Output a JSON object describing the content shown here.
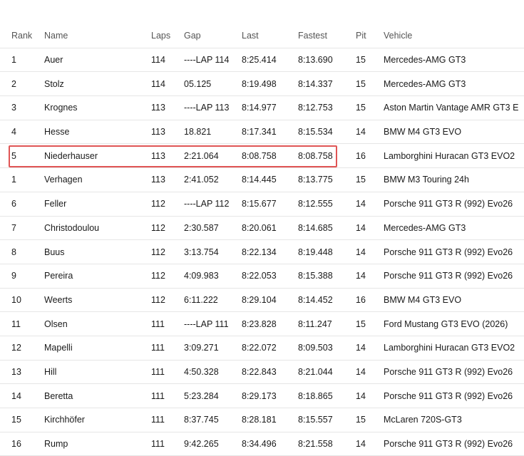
{
  "columns": {
    "rank": "Rank",
    "name": "Name",
    "laps": "Laps",
    "gap": "Gap",
    "last": "Last",
    "fastest": "Fastest",
    "pit": "Pit",
    "vehicle": "Vehicle"
  },
  "rows": [
    {
      "rank": "1",
      "name": "Auer",
      "laps": "114",
      "gap": "----LAP 114",
      "last": "8:25.414",
      "fastest": "8:13.690",
      "pit": "15",
      "vehicle": "Mercedes-AMG GT3"
    },
    {
      "rank": "2",
      "name": "Stolz",
      "laps": "114",
      "gap": "05.125",
      "last": "8:19.498",
      "fastest": "8:14.337",
      "pit": "15",
      "vehicle": "Mercedes-AMG GT3"
    },
    {
      "rank": "3",
      "name": "Krognes",
      "laps": "113",
      "gap": "----LAP 113",
      "last": "8:14.977",
      "fastest": "8:12.753",
      "pit": "15",
      "vehicle": "Aston Martin Vantage AMR GT3 E..."
    },
    {
      "rank": "4",
      "name": "Hesse",
      "laps": "113",
      "gap": "18.821",
      "last": "8:17.341",
      "fastest": "8:15.534",
      "pit": "14",
      "vehicle": "BMW M4 GT3 EVO"
    },
    {
      "rank": "5",
      "name": "Niederhauser",
      "laps": "113",
      "gap": "2:21.064",
      "last": "8:08.758",
      "fastest": "8:08.758",
      "pit": "16",
      "vehicle": "Lamborghini Huracan GT3 EVO2"
    },
    {
      "rank": "1",
      "name": "Verhagen",
      "laps": "113",
      "gap": "2:41.052",
      "last": "8:14.445",
      "fastest": "8:13.775",
      "pit": "15",
      "vehicle": "BMW M3 Touring 24h"
    },
    {
      "rank": "6",
      "name": "Feller",
      "laps": "112",
      "gap": "----LAP 112",
      "last": "8:15.677",
      "fastest": "8:12.555",
      "pit": "14",
      "vehicle": "Porsche 911 GT3 R (992) Evo26"
    },
    {
      "rank": "7",
      "name": "Christodoulou",
      "laps": "112",
      "gap": "2:30.587",
      "last": "8:20.061",
      "fastest": "8:14.685",
      "pit": "14",
      "vehicle": "Mercedes-AMG GT3"
    },
    {
      "rank": "8",
      "name": "Buus",
      "laps": "112",
      "gap": "3:13.754",
      "last": "8:22.134",
      "fastest": "8:19.448",
      "pit": "14",
      "vehicle": "Porsche 911 GT3 R (992) Evo26"
    },
    {
      "rank": "9",
      "name": "Pereira",
      "laps": "112",
      "gap": "4:09.983",
      "last": "8:22.053",
      "fastest": "8:15.388",
      "pit": "14",
      "vehicle": "Porsche 911 GT3 R (992) Evo26"
    },
    {
      "rank": "10",
      "name": "Weerts",
      "laps": "112",
      "gap": "6:11.222",
      "last": "8:29.104",
      "fastest": "8:14.452",
      "pit": "16",
      "vehicle": "BMW M4 GT3 EVO"
    },
    {
      "rank": "11",
      "name": "Olsen",
      "laps": "111",
      "gap": "----LAP 111",
      "last": "8:23.828",
      "fastest": "8:11.247",
      "pit": "15",
      "vehicle": "Ford Mustang GT3 EVO (2026)"
    },
    {
      "rank": "12",
      "name": "Mapelli",
      "laps": "111",
      "gap": "3:09.271",
      "last": "8:22.072",
      "fastest": "8:09.503",
      "pit": "14",
      "vehicle": "Lamborghini Huracan GT3 EVO2"
    },
    {
      "rank": "13",
      "name": "Hill",
      "laps": "111",
      "gap": "4:50.328",
      "last": "8:22.843",
      "fastest": "8:21.044",
      "pit": "14",
      "vehicle": "Porsche 911 GT3 R (992) Evo26"
    },
    {
      "rank": "14",
      "name": "Beretta",
      "laps": "111",
      "gap": "5:23.284",
      "last": "8:29.173",
      "fastest": "8:18.865",
      "pit": "14",
      "vehicle": "Porsche 911 GT3 R (992) Evo26"
    },
    {
      "rank": "15",
      "name": "Kirchhöfer",
      "laps": "111",
      "gap": "8:37.745",
      "last": "8:28.181",
      "fastest": "8:15.557",
      "pit": "15",
      "vehicle": "McLaren 720S-GT3"
    },
    {
      "rank": "16",
      "name": "Rump",
      "laps": "111",
      "gap": "9:42.265",
      "last": "8:34.496",
      "fastest": "8:21.558",
      "pit": "14",
      "vehicle": "Porsche 911 GT3 R (992) Evo26"
    }
  ],
  "highlight": {
    "row_index": 4,
    "color": "#e05555"
  }
}
